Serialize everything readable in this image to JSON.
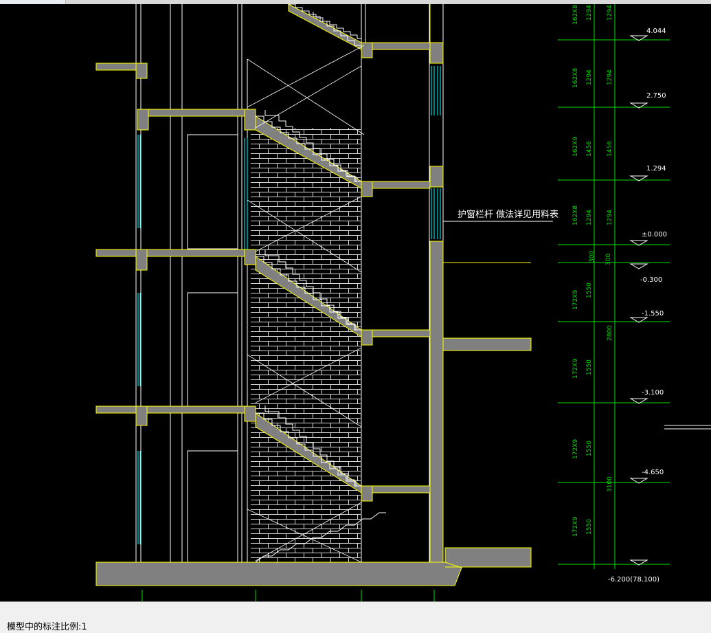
{
  "window": {
    "tab_stub": ""
  },
  "drawing": {
    "note_text": "护窗栏杆 做法详见用料表",
    "levels": [
      {
        "label": "4.044"
      },
      {
        "label": "2.750"
      },
      {
        "label": "1.294"
      },
      {
        "label": "±0.000"
      },
      {
        "label": "-0.300"
      },
      {
        "label": "-1.550"
      },
      {
        "label": "-3.100"
      },
      {
        "label": "-4.650"
      },
      {
        "label": "-6.200(78.100)"
      }
    ],
    "dims_outer": [
      "162X8",
      "162X8",
      "162X9",
      "162X8",
      "300",
      "172X9",
      "172X9",
      "172X9",
      "172X9"
    ],
    "dims_mid": [
      "1294",
      "1294",
      "1456",
      "1294",
      "1550",
      "1550",
      "1550",
      "1550"
    ],
    "dims_inner": [
      "1294",
      "1294",
      "1456",
      "1294",
      "300",
      "2800",
      "3100"
    ],
    "colors": {
      "background": "#000000",
      "section": "#808080",
      "outline": "#ffff00",
      "dim": "#00e000",
      "window": "#00ffff",
      "line": "#ffffff"
    }
  },
  "statusbar": {
    "text": "模型中的标注比例:1"
  }
}
